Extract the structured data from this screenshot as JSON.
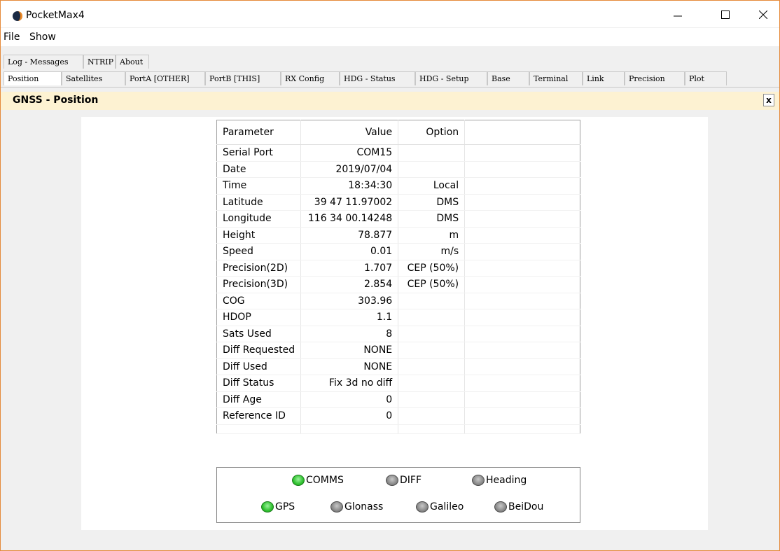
{
  "window": {
    "title": "PocketMax4"
  },
  "menu": [
    "File",
    "Show"
  ],
  "tabs_row1": [
    "Log - Messages",
    "NTRIP",
    "About"
  ],
  "tabs_row2": [
    "Position",
    "Satellites",
    "PortA [OTHER]",
    "PortB [THIS]",
    "RX Config",
    "HDG - Status",
    "HDG - Setup",
    "Base",
    "Terminal",
    "Link",
    "Precision",
    "Plot"
  ],
  "panel": {
    "title": "GNSS - Position",
    "close_label": "x"
  },
  "table": {
    "headers": [
      "Parameter",
      "Value",
      "Option"
    ],
    "rows": [
      [
        "Serial Port",
        "COM15",
        ""
      ],
      [
        "Date",
        "2019/07/04",
        ""
      ],
      [
        "Time",
        "18:34:30",
        "Local"
      ],
      [
        "Latitude",
        "39 47 11.97002",
        "DMS"
      ],
      [
        "Longitude",
        "116 34 00.14248",
        "DMS"
      ],
      [
        "Height",
        "78.877",
        "m"
      ],
      [
        "Speed",
        "0.01",
        "m/s"
      ],
      [
        "Precision(2D)",
        "1.707",
        "CEP (50%)"
      ],
      [
        "Precision(3D)",
        "2.854",
        "CEP (50%)"
      ],
      [
        "COG",
        "303.96",
        ""
      ],
      [
        "HDOP",
        "1.1",
        ""
      ],
      [
        "Sats Used",
        "8",
        ""
      ],
      [
        "Diff Requested",
        "NONE",
        ""
      ],
      [
        "Diff Used",
        "NONE",
        ""
      ],
      [
        "Diff Status",
        "Fix 3d no diff",
        ""
      ],
      [
        "Diff Age",
        "0",
        ""
      ],
      [
        "Reference ID",
        "0",
        ""
      ]
    ]
  },
  "status": [
    {
      "label": "COMMS",
      "state": "green"
    },
    {
      "label": "DIFF",
      "state": "gray"
    },
    {
      "label": "Heading",
      "state": "gray"
    },
    {
      "label": "GPS",
      "state": "green"
    },
    {
      "label": "Glonass",
      "state": "gray"
    },
    {
      "label": "Galileo",
      "state": "gray"
    },
    {
      "label": "BeiDou",
      "state": "gray"
    }
  ],
  "colors": {
    "accent": "#e58a3a",
    "header_bg": "#fdf2d2",
    "led_on": "#2fc12f",
    "led_off": "#8a8a8a"
  }
}
